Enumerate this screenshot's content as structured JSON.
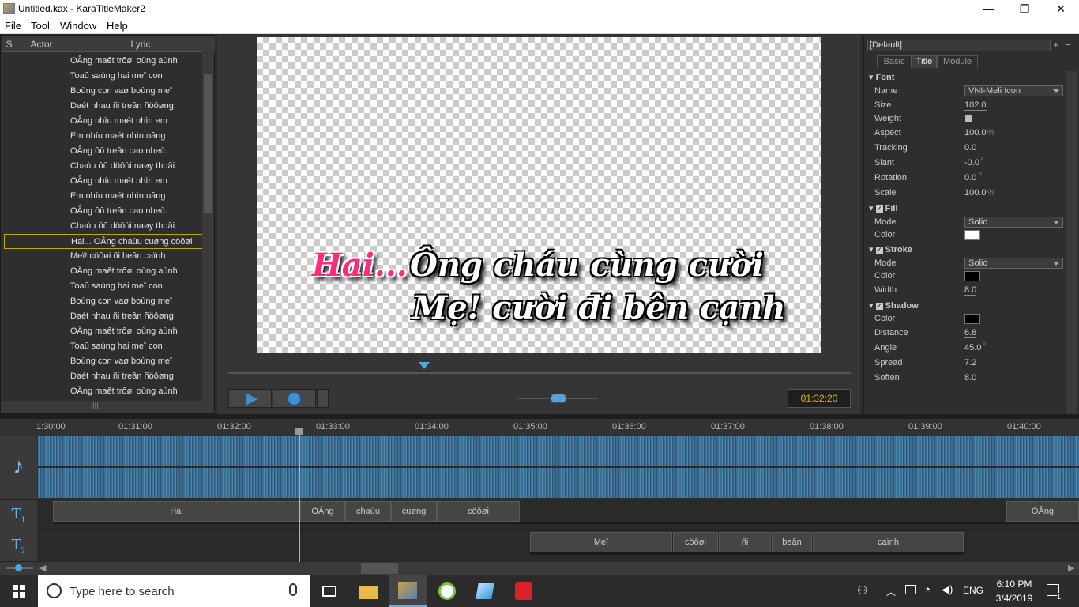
{
  "window": {
    "title": "Untitled.kax - KaraTitleMaker2",
    "minimize": "—",
    "maximize": "❐",
    "close": "✕"
  },
  "menu": [
    "File",
    "Tool",
    "Window",
    "Help"
  ],
  "lyricList": {
    "headers": {
      "s": "S",
      "actor": "Actor",
      "lyric": "Lyric"
    },
    "rows": [
      "OÂng maêt trôøi oùng aùnh",
      "Toaû saùng hai meï con",
      "Boùng con vaø boùng meï",
      "Daét nhau ñi treân ñöôøng",
      "OÂng nhìu maét nhìn em",
      "Em nhíu maét nhìn oâng",
      "OÂng ôû treân cao nheù.",
      "Chaùu ôû döôùi naøy thoâi.",
      "OÂng nhíu maét nhìn em",
      "Em nhíu maét nhìn oâng",
      "OÂng ôû treân cao nheù.",
      "Chaùu ôû döôùi naøy thoâi.",
      "Hai... OÂng chaùu cuøng cöôøi",
      "Meï! cöôøi ñi beân caïnh",
      "OÂng maêt trôøi oùng aùnh",
      "Toaû saùng hai meï con",
      "Boùng con vaø boùng meï",
      "Daét nhau ñi treân ñöôøng",
      "OÂng maêt trôøi oùng aùnh",
      "Toaû saùng hai meï con",
      "Boùng con vaø boùng meï",
      "Daét nhau ñi treân ñöôøng",
      "OÂng maêt trôøi oùng aùnh"
    ],
    "selectedIndex": 12,
    "scrollGrip": "|||"
  },
  "preview": {
    "line1Highlight": "Hai...",
    "line1Rest": "Ông cháu cùng cười",
    "line2": "Mẹ! cười đi bên cạnh",
    "time": "01:32:20"
  },
  "properties": {
    "preset": "[Default]",
    "tabs": [
      "Basic",
      "Title",
      "Module"
    ],
    "activeTab": "Title",
    "fontSection": "Font",
    "font": {
      "name": "VNI-Meli Icon",
      "size": "102.0",
      "aspect": "100.0",
      "aspectUnit": "%",
      "tracking": "0.0",
      "slant": "-0.0",
      "slantUnit": "°",
      "rotation": "0.0",
      "rotationUnit": "°",
      "scale": "100.0",
      "scaleUnit": "%"
    },
    "labels": {
      "name": "Name",
      "size": "Size",
      "weight": "Weight",
      "aspect": "Aspect",
      "tracking": "Tracking",
      "slant": "Slant",
      "rotation": "Rotation",
      "scale": "Scale",
      "mode": "Mode",
      "color": "Color",
      "width": "Width",
      "distance": "Distance",
      "angle": "Angle",
      "spread": "Spread",
      "soften": "Soften"
    },
    "fill": {
      "title": "Fill",
      "mode": "Solid",
      "color": "#ffffff"
    },
    "stroke": {
      "title": "Stroke",
      "mode": "Solid",
      "color": "#000000",
      "width": "8.0"
    },
    "shadow": {
      "title": "Shadow",
      "color": "#000000",
      "distance": "6.8",
      "angle": "45.0",
      "angleUnit": "°",
      "spread": "7.2",
      "soften": "8.0"
    }
  },
  "timeline": {
    "ticks": [
      "1:30:00",
      "01:31:00",
      "01:32:00",
      "01:33:00",
      "01:34:00",
      "01:35:00",
      "01:36:00",
      "01:37:00",
      "01:38:00",
      "01:39:00",
      "01:40:00"
    ],
    "track1": [
      "Hai",
      "OÂng",
      "chaùu",
      "cuøng",
      "cöôøi",
      "OÂng"
    ],
    "track2": [
      "Meï",
      "cöôøi",
      "ñi",
      "beân",
      "caïnh"
    ]
  },
  "taskbar": {
    "search": "Type here to search",
    "lang": "ENG",
    "time": "6:10 PM",
    "date": "3/4/2019",
    "notif": "1"
  },
  "colors": {
    "accent": "#e0b600",
    "pinkHighlight": "#ff2a7a",
    "wave": "#3d6f93"
  }
}
